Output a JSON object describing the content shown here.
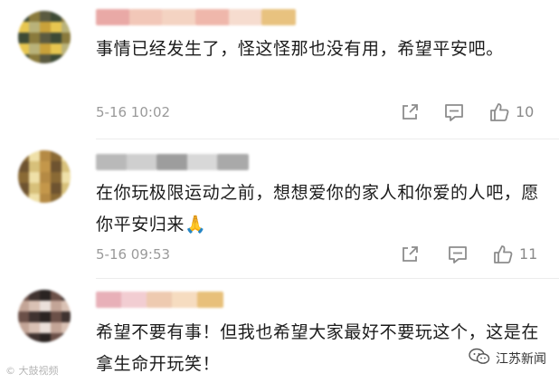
{
  "comments": [
    {
      "text": "事情已经发生了，怪这怪那也没有用，希望平安吧。",
      "time": "5-16 10:02",
      "likes": "10",
      "avatar_colors": [
        "#3d4a35",
        "#c9a23a",
        "#8a7a3c",
        "#e7c650",
        "#5b5a40",
        "#b9b27a"
      ],
      "username_colors": [
        "#e9a9a6",
        "#f2c7b8",
        "#f4d3c2",
        "#efb7ab",
        "#f6dccf",
        "#e8c27f"
      ]
    },
    {
      "text": "在你玩极限运动之前，想想爱你的家人和你爱的人吧，愿你平安归来🙏",
      "time": "5-16 09:53",
      "likes": "11",
      "avatar_colors": [
        "#d7c07a",
        "#8a6a35",
        "#c4974a",
        "#efe0a8",
        "#6e5330",
        "#b58a44"
      ],
      "username_colors": [
        "#b9b9b9",
        "#cfcfcf",
        "#9d9d9d",
        "#d8d8d8",
        "#a9a9a9"
      ]
    },
    {
      "text": "希望不要有事！但我也希望大家最好不要玩这个，这是在拿生命开玩笑！",
      "time": "",
      "likes": "",
      "avatar_colors": [
        "#2a2422",
        "#d9c1b4",
        "#6b5048",
        "#ebe0da",
        "#403330",
        "#c3a597"
      ],
      "username_colors": [
        "#e8b0b8",
        "#f2cdd2",
        "#eecab0",
        "#f6dcc0",
        "#e8c07a"
      ]
    }
  ],
  "watermark_left": "© 大鼓视频",
  "watermark_right": "江苏新闻",
  "icons": [
    "share-icon",
    "comment-icon",
    "like-icon",
    "wechat-icon"
  ]
}
